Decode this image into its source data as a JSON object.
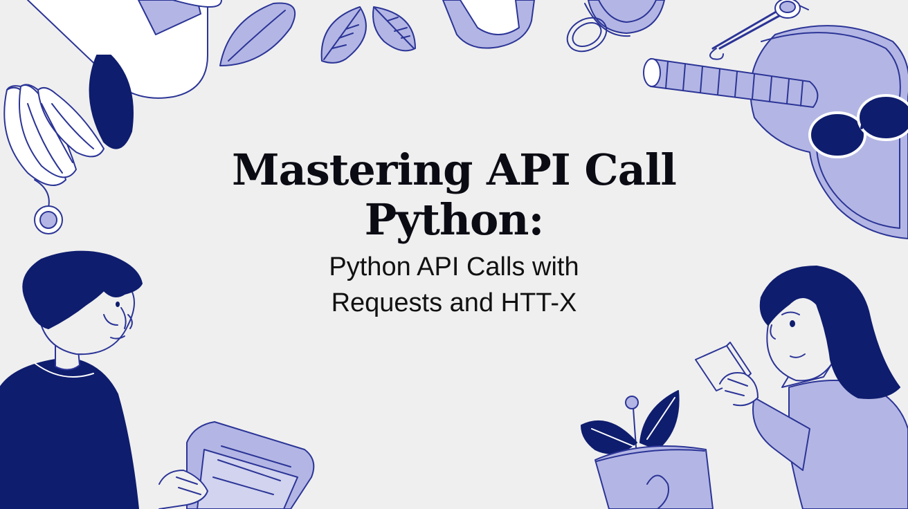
{
  "headline": {
    "title_lines": [
      "Mastering API Call",
      "Python:"
    ],
    "subtitle_lines": [
      "Python API Calls with",
      "Requests and HTT-X"
    ]
  },
  "illustration": {
    "colors": {
      "background": "#efefef",
      "navy": "#0f1d6e",
      "lavender": "#b3b6e4",
      "outline": "#2b3496"
    },
    "elements": [
      "arm-with-sleeve",
      "cylinder-jar",
      "oval-leaf",
      "leaf-pair",
      "mug",
      "teacup",
      "spoon-hook",
      "banana-bunch",
      "pendulum-ball",
      "striped-cigar",
      "sunglasses-head",
      "man-with-book",
      "woman-with-cube",
      "potted-plant"
    ]
  }
}
